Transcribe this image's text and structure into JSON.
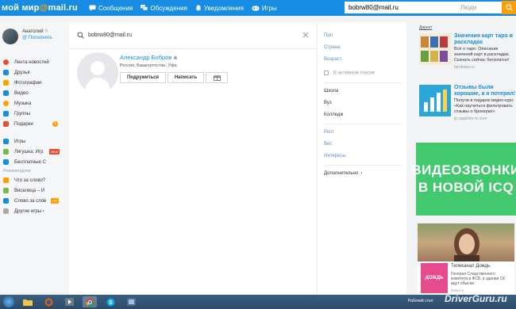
{
  "header": {
    "logo_text": "мой мир",
    "logo_at": "@",
    "logo_domain": "mail.ru",
    "nav": [
      {
        "label": "Сообщения",
        "icon": "messages-icon"
      },
      {
        "label": "Обсуждения",
        "icon": "discussions-icon"
      },
      {
        "label": "Уведомления",
        "icon": "bell-icon"
      },
      {
        "label": "Игры",
        "icon": "gamepad-icon"
      }
    ],
    "search_value": "bobrw80@mail.ru",
    "search_scope": "Люди"
  },
  "sidebar": {
    "profile_name": "Анатолий",
    "profile_add": "Пополнить",
    "items": [
      {
        "label": "Лента новостей",
        "color": "#e64e2f"
      },
      {
        "label": "Друзья",
        "color": "#168de2"
      },
      {
        "label": "Фотографии",
        "color": "#ff9e00"
      },
      {
        "label": "Видео",
        "color": "#168de2"
      },
      {
        "label": "Музыка",
        "color": "#ff9e00"
      },
      {
        "label": "Группы",
        "color": "#168de2"
      },
      {
        "label": "Подарки",
        "color": "#e64e2f",
        "badge": "1"
      }
    ],
    "games": [
      {
        "label": "Игры",
        "color": "#168de2"
      },
      {
        "label": "Лягушка: Игр",
        "color": "#7ab648",
        "tag": "NEW"
      },
      {
        "label": "Бесплатные С",
        "color": "#168de2"
      }
    ],
    "recommended_title": "Рекомендуем",
    "recommended": [
      {
        "label": "Что за слово?",
        "color": "#ff9e00"
      },
      {
        "label": "Виселица – И",
        "color": "#7ab648"
      },
      {
        "label": "Слово за слов",
        "color": "#168de2",
        "tag": "HIT"
      },
      {
        "label": "Другие игры",
        "color": "#aaa",
        "arrow": "›"
      }
    ]
  },
  "main": {
    "query": "bobrw80@mail.ru",
    "result": {
      "name": "Александр Бобров",
      "location": "Россия, Башкортостан, Уфа",
      "add_friend": "Подружиться",
      "write": "Написать"
    },
    "filters": {
      "gender": "Пол",
      "country": "Страна",
      "age": "Возраст",
      "active_search": "В активном поиске",
      "school": "Школа",
      "university": "Вуз",
      "college": "Колледж",
      "height": "Рост",
      "weight": "Вес",
      "interests": "Интересы",
      "more": "Дополнительно",
      "more_arrow": "›"
    }
  },
  "ads": {
    "direct": "Директ",
    "ad1": {
      "title": "Значения карт таро в раскладах",
      "desc": "Всё о таро. Описание значений карт в раскладах. Скачать сейчас бесплатно!",
      "site": "tarotman.ru"
    },
    "ad2": {
      "title": "Отзывы были хорошие, а я потерял!",
      "desc": "Получи в подарок видео-курс «Как научиться фильтровать отзывы о брокерах»",
      "site": "lp.sapphire-m.com"
    },
    "banner_lines": [
      "ВИДЕОЗВОНКИ",
      "В НОВОЙ ICQ"
    ],
    "video": {
      "logo": "ДОЖДЬ",
      "title": "Телеканал Дождь",
      "desc": "Генерал Следственного комитета в ФСБ, в здании СК идут обыски",
      "site": "tvrain.ru"
    }
  },
  "taskbar": {
    "tray_text": "Рабочий стол",
    "watermark": "DriverGuru.ru"
  }
}
